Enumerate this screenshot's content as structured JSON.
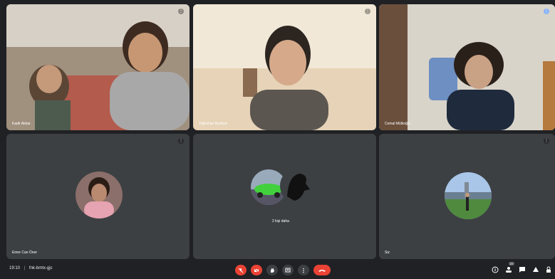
{
  "tiles": [
    {
      "name": "Kadir Akbar",
      "indicator": "⋮"
    },
    {
      "name": "Yiğitcihan Bozkurt",
      "indicator": "⋮"
    },
    {
      "name": "Cemal Mülkoğlu",
      "indicator": "⋮"
    },
    {
      "name": "Emre Can Öner",
      "indicator": "⋮"
    },
    {
      "name": "",
      "indicator": ""
    },
    {
      "name": "Siz",
      "indicator": "⋮"
    }
  ],
  "others_label": "2 kişi daha",
  "meeting": {
    "time": "19:10",
    "separator": "|",
    "code": "fnk-bmtx-gjc"
  },
  "chat_badge": "27",
  "colors": {
    "accent": "#8ab4f8",
    "danger": "#ea4335",
    "panel": "#3c4043",
    "background": "#202124"
  }
}
